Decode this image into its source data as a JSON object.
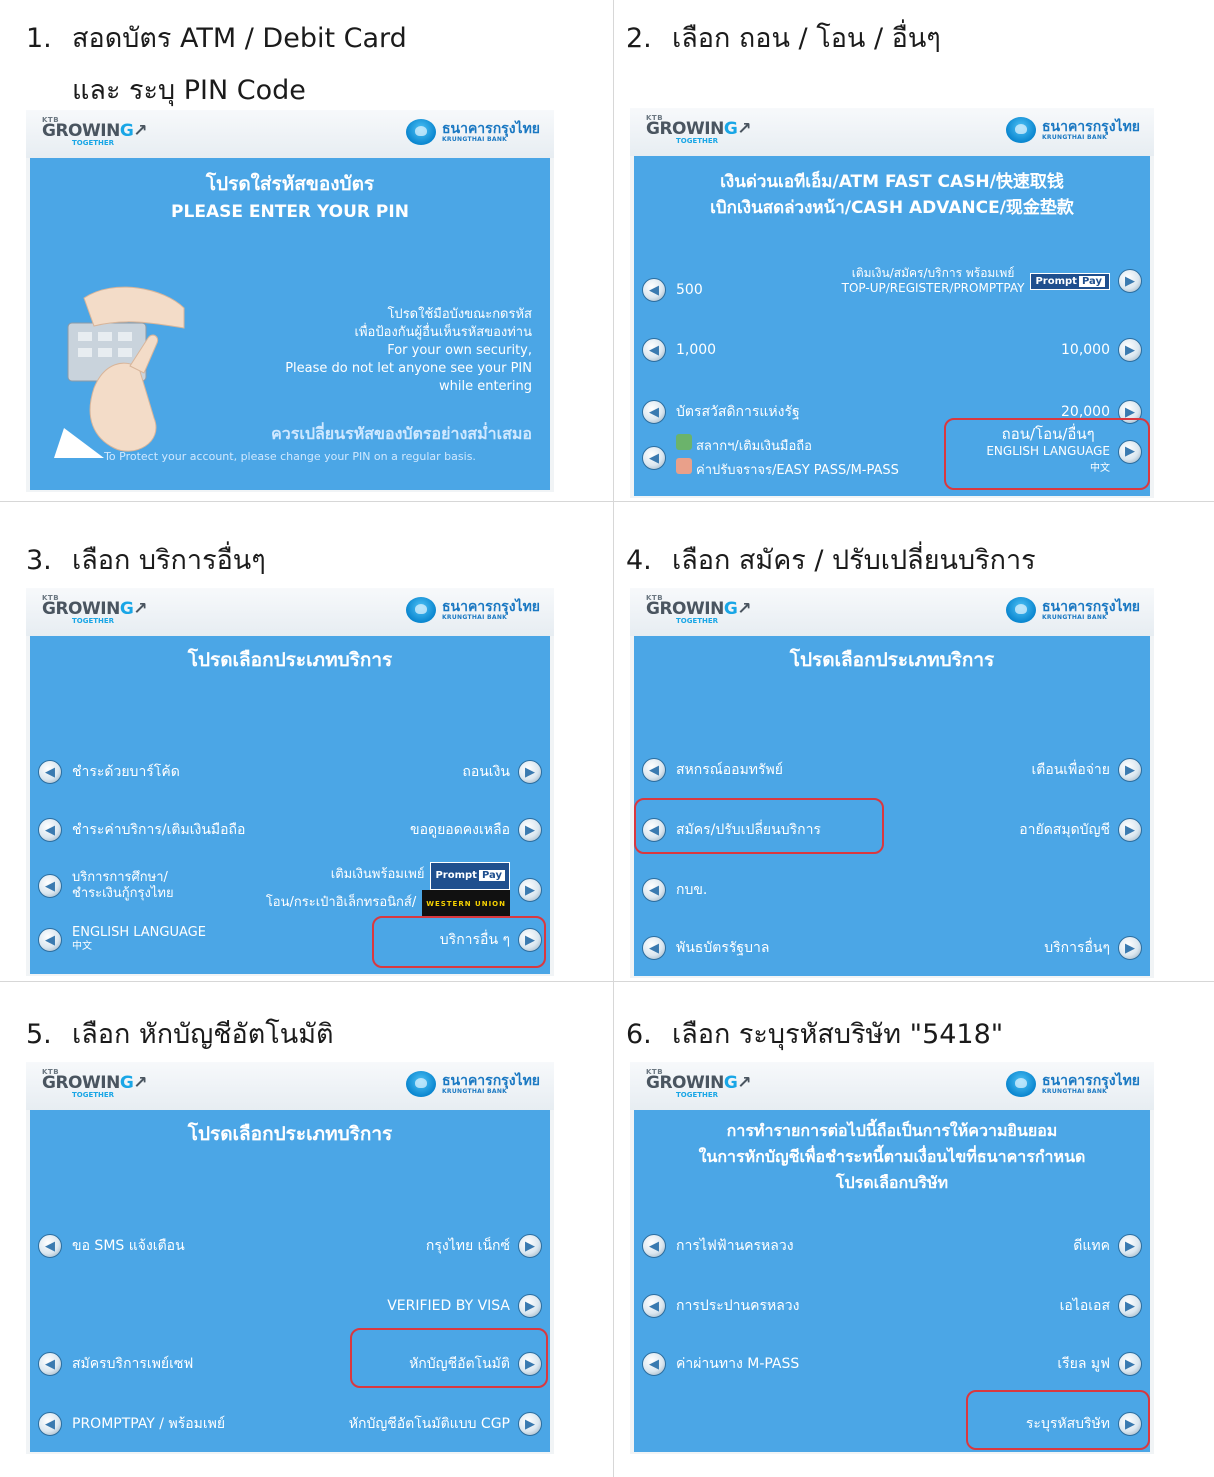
{
  "steps": [
    {
      "number": "1.",
      "title": "สอดบัตร ATM / Debit Card",
      "subtitle": "และ ระบุ PIN Code",
      "screen": {
        "title_lines": [
          "โปรดใส่รหัสของบัตร",
          "PLEASE ENTER YOUR PIN"
        ],
        "security_text": [
          "โปรดใช้มือบังขณะกดรหัส",
          "เพื่อป้องกันผู้อื่นเห็นรหัสของท่าน",
          "For your own security,",
          "Please do not let anyone see your PIN",
          "while entering"
        ],
        "change_pin_th": "ควรเปลี่ยนรหัสของบัตรอย่างสม่ำเสมอ",
        "change_pin_en": "To Protect your account, please change your PIN on a regular basis."
      }
    },
    {
      "number": "2.",
      "title": "เลือก ถอน / โอน / อื่นๆ",
      "screen": {
        "title_lines": [
          "เงินด่วนเอทีเอ็ม/ATM FAST CASH/快速取钱",
          "เบิกเงินสดล่วงหน้า/CASH ADVANCE/现金垫款"
        ],
        "left": [
          "500",
          "1,000",
          "บัตรสวัสดิการแห่งรัฐ"
        ],
        "left_bottom": [
          "สลากฯ/เติมเงินมือถือ",
          "ค่าปรับจราจร/EASY PASS/M-PASS"
        ],
        "right_top": [
          "เติมเงิน/สมัคร/บริการ พร้อมเพย์",
          "TOP-UP/REGISTER/PROMPTPAY"
        ],
        "right": [
          "10,000",
          "20,000"
        ],
        "right_bottom": [
          "ถอน/โอน/อื่นๆ",
          "ENGLISH LANGUAGE",
          "中文"
        ],
        "promptpay_logo": [
          "Prompt",
          "Pay"
        ]
      }
    },
    {
      "number": "3.",
      "title": "เลือก บริการอื่นๆ",
      "screen": {
        "title": "โปรดเลือกประเภทบริการ",
        "left": [
          "ชำระด้วยบาร์โค้ด",
          "ชำระค่าบริการ/เติมเงินมือถือ"
        ],
        "left_edu": [
          "บริการการศึกษา/",
          "ชำระเงินกู้กรุงไทย"
        ],
        "left_lang": [
          "ENGLISH LANGUAGE",
          "中文"
        ],
        "right": [
          "ถอนเงิน",
          "ขอดูยอดคงเหลือ"
        ],
        "right_pp": [
          "เติมเงินพร้อมเพย์",
          "โอน/กระเป๋าอิเล็กทรอนิกส์/"
        ],
        "right_other": "บริการอื่น ๆ",
        "promptpay_logo": [
          "Prompt",
          "Pay"
        ],
        "wu_logo": [
          "WESTERN",
          "UNION"
        ]
      }
    },
    {
      "number": "4.",
      "title": "เลือก สมัคร / ปรับเปลี่ยนบริการ",
      "screen": {
        "title": "โปรดเลือกประเภทบริการ",
        "left": [
          "สหกรณ์ออมทรัพย์",
          "สมัคร/ปรับเปลี่ยนบริการ",
          "กบข.",
          "พันธบัตรรัฐบาล"
        ],
        "right": [
          "เตือนเพื่อจ่าย",
          "อายัดสมุดบัญชี",
          "บริการอื่นๆ"
        ]
      }
    },
    {
      "number": "5.",
      "title": "เลือก หักบัญชีอัตโนมัติ",
      "screen": {
        "title": "โปรดเลือกประเภทบริการ",
        "left": [
          "ขอ SMS แจ้งเตือน",
          "สมัครบริการเพย์เซฟ",
          "PROMPTPAY / พร้อมเพย์"
        ],
        "right": [
          "กรุงไทย เน็กซ์",
          "VERIFIED BY VISA",
          "หักบัญชีอัตโนมัติ",
          "หักบัญชีอัตโนมัติแบบ CGP"
        ]
      }
    },
    {
      "number": "6.",
      "title": "เลือก ระบุรหัสบริษัท \"5418\"",
      "screen": {
        "title_lines": [
          "การทำรายการต่อไปนี้ถือเป็นการให้ความยินยอม",
          "ในการหักบัญชีเพื่อชำระหนี้ตามเงื่อนไขที่ธนาคารกำหนด",
          "โปรดเลือกบริษัท"
        ],
        "left": [
          "การไฟฟ้านครหลวง",
          "การประปานครหลวง",
          "ค่าผ่านทาง M-PASS"
        ],
        "right": [
          "ดีแทค",
          "เอไอเอส",
          "เรียล มูฟ",
          "ระบุรหัสบริษัท"
        ]
      }
    }
  ],
  "brand": {
    "ktb": "KTB",
    "growing_a": "GROWIN",
    "growing_b": "G",
    "together": "TOGETHER",
    "bank_th": "ธนาคารกรุงไทย",
    "bank_en": "KRUNGTHAI BANK"
  },
  "colors": {
    "screen_blue": "#4ba6e6",
    "highlight_red": "#d9383f"
  }
}
